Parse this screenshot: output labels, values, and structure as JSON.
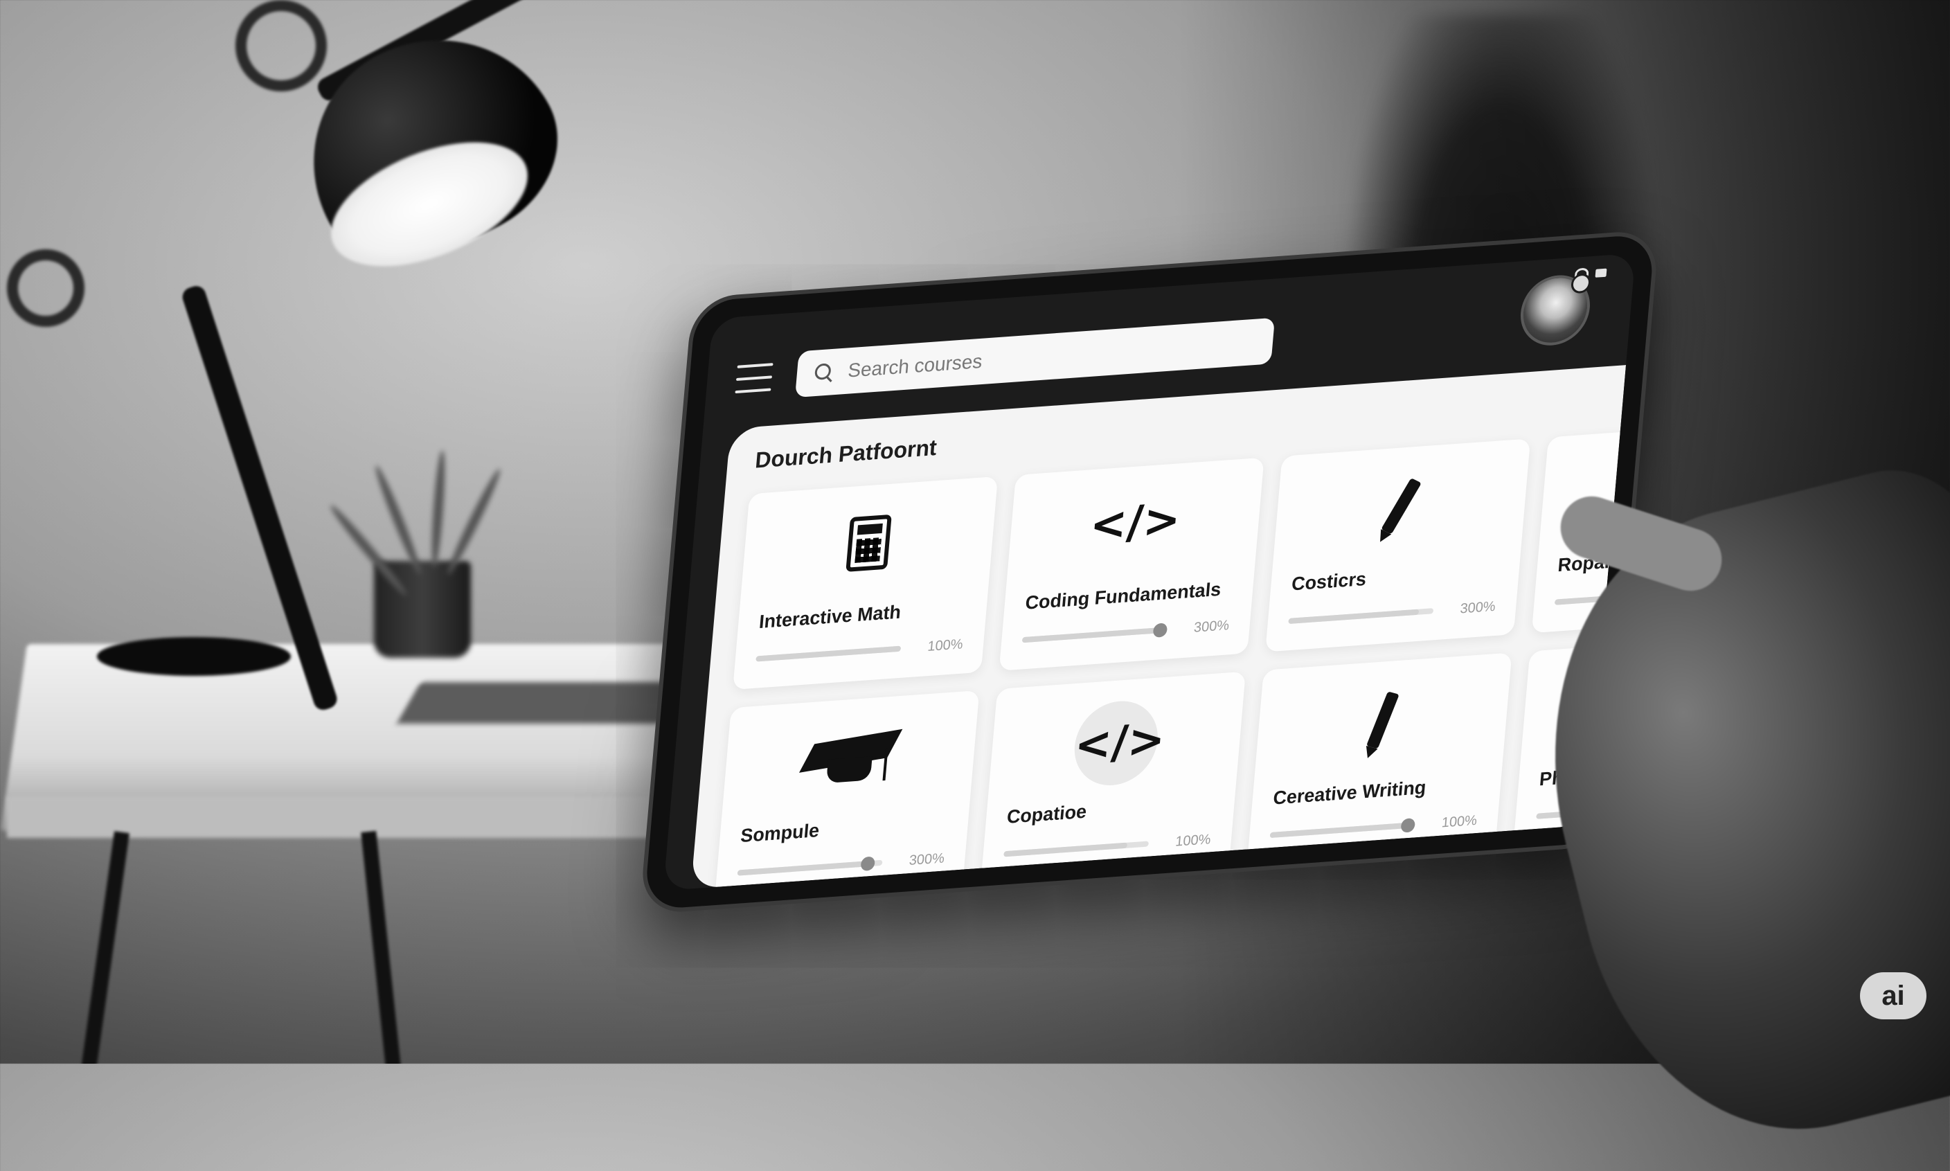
{
  "search": {
    "placeholder": "Search courses"
  },
  "panel": {
    "title": "Dourch Patfoornt"
  },
  "courses": [
    {
      "title": "Interactive Math",
      "progress_label": "100%",
      "progress": 1.0,
      "icon": "calculator-icon"
    },
    {
      "title": "Coding Fundamentals",
      "progress_label": "300%",
      "progress": 0.95,
      "icon": "code-icon"
    },
    {
      "title": "Costicrs",
      "progress_label": "300%",
      "progress": 0.9,
      "icon": "pencil-icon"
    },
    {
      "title": "Ropamel",
      "progress_label": "",
      "progress": 0.8,
      "icon": "calculator-icon"
    },
    {
      "title": "Sompule",
      "progress_label": "300%",
      "progress": 0.9,
      "icon": "graduation-cap-icon"
    },
    {
      "title": "Copatioe",
      "progress_label": "100%",
      "progress": 0.85,
      "icon": "code-icon"
    },
    {
      "title": "Cereative Writing",
      "progress_label": "100%",
      "progress": 0.95,
      "icon": "pen-icon"
    },
    {
      "title": "Phpemale a",
      "progress_label": "",
      "progress": 0.6,
      "icon": "screen-icon"
    }
  ],
  "icons": {
    "code": "</>",
    "screen": "▭"
  },
  "badge": {
    "label": "ai"
  },
  "colors": {
    "screen_bg": "#1c1c1c",
    "panel_bg": "#f4f4f4",
    "card_bg": "#fdfdfd"
  }
}
